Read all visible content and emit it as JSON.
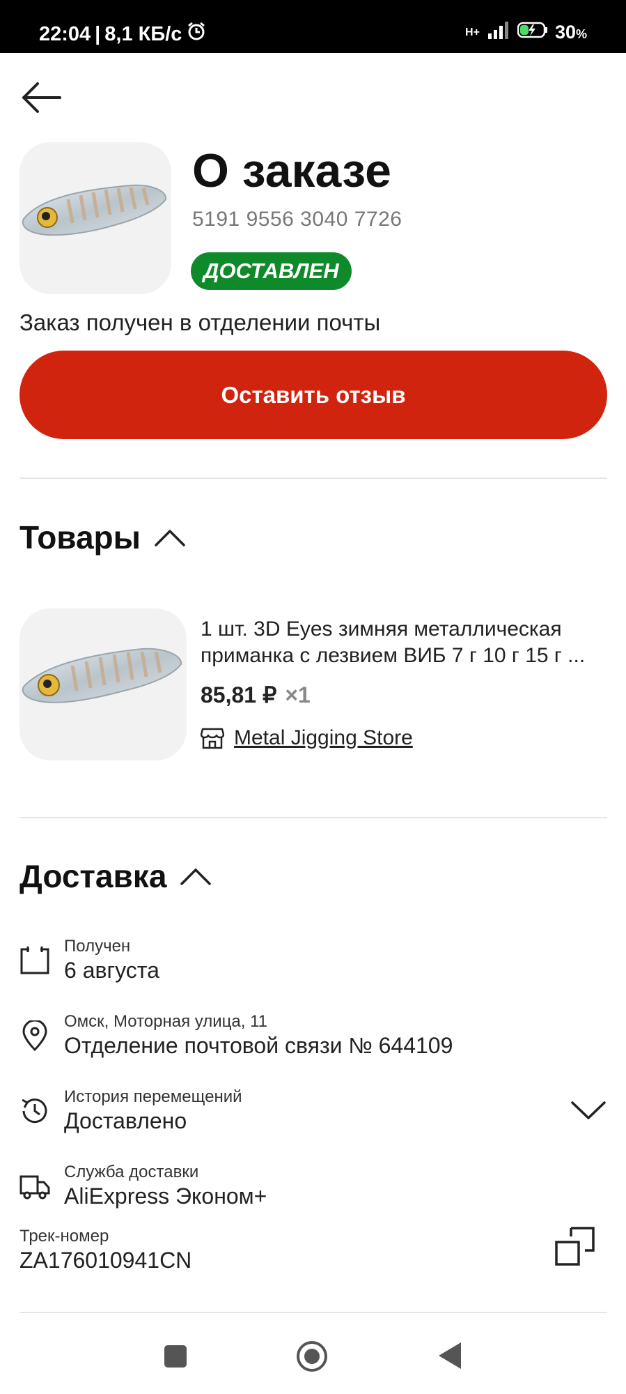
{
  "status_bar": {
    "time": "22:04",
    "speed": "8,1 КБ/с",
    "network": "H+",
    "battery": "30",
    "battery_unit": "%"
  },
  "header": {
    "title": "О заказе",
    "order_number": "5191 9556 3040 7726",
    "status_badge": "ДОСТАВЛЕН",
    "status_description": "Заказ получен в отделении почты",
    "review_button": "Оставить отзыв"
  },
  "products_section": {
    "title": "Товары",
    "items": [
      {
        "title_line1": "1 шт. 3D Eyes зимняя металлическая",
        "title_line2": "приманка с лезвием ВИБ 7 г 10 г 15 г ...",
        "price": "85,81 ₽",
        "quantity": "×1",
        "store": "Metal Jigging Store"
      }
    ]
  },
  "delivery_section": {
    "title": "Доставка",
    "received_label": "Получен",
    "received_value": "6 августа",
    "address_label": "Омск, Моторная улица, 11",
    "address_value": "Отделение почтовой связи № 644109",
    "history_label": "История перемещений",
    "history_value": "Доставлено",
    "service_label": "Служба доставки",
    "service_value": "AliExpress Эконом+",
    "tracking_label": "Трек-номер",
    "tracking_value": "ZA176010941CN"
  },
  "colors": {
    "accent": "#d0240f",
    "status_green": "#0f8a2a"
  }
}
